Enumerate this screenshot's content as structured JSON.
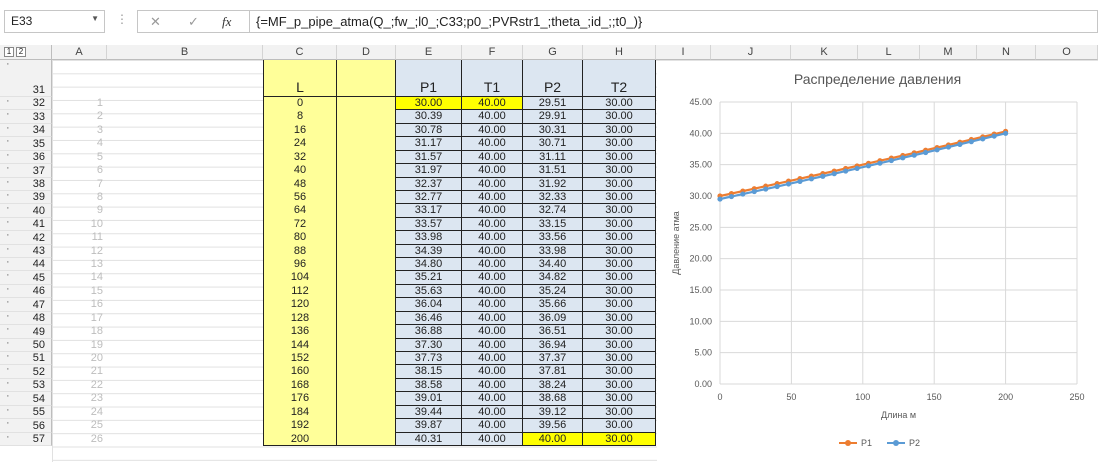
{
  "formula_bar": {
    "name_box": "E33",
    "cancel_icon": "✕",
    "enter_icon": "✓",
    "fx_label": "fx",
    "formula": "{=MF_p_pipe_atma(Q_;fw_;l0_;C33;p0_;PVRstr1_;theta_;id_;;t0_)}"
  },
  "outline_levels": [
    "1",
    "2"
  ],
  "columns": [
    "A",
    "B",
    "C",
    "D",
    "E",
    "F",
    "G",
    "H",
    "I",
    "J",
    "K",
    "L",
    "M",
    "N",
    "O"
  ],
  "header_row": {
    "row": "31",
    "C": "L",
    "E": "P1",
    "F": "T1",
    "G": "P2",
    "H": "T2"
  },
  "rows": [
    {
      "row": "32",
      "A": "1",
      "C": "0",
      "E": "30.00",
      "F": "40.00",
      "G": "29.51",
      "H": "30.00"
    },
    {
      "row": "33",
      "A": "2",
      "C": "8",
      "E": "30.39",
      "F": "40.00",
      "G": "29.91",
      "H": "30.00"
    },
    {
      "row": "34",
      "A": "3",
      "C": "16",
      "E": "30.78",
      "F": "40.00",
      "G": "30.31",
      "H": "30.00"
    },
    {
      "row": "35",
      "A": "4",
      "C": "24",
      "E": "31.17",
      "F": "40.00",
      "G": "30.71",
      "H": "30.00"
    },
    {
      "row": "36",
      "A": "5",
      "C": "32",
      "E": "31.57",
      "F": "40.00",
      "G": "31.11",
      "H": "30.00"
    },
    {
      "row": "37",
      "A": "6",
      "C": "40",
      "E": "31.97",
      "F": "40.00",
      "G": "31.51",
      "H": "30.00"
    },
    {
      "row": "38",
      "A": "7",
      "C": "48",
      "E": "32.37",
      "F": "40.00",
      "G": "31.92",
      "H": "30.00"
    },
    {
      "row": "39",
      "A": "8",
      "C": "56",
      "E": "32.77",
      "F": "40.00",
      "G": "32.33",
      "H": "30.00"
    },
    {
      "row": "40",
      "A": "9",
      "C": "64",
      "E": "33.17",
      "F": "40.00",
      "G": "32.74",
      "H": "30.00"
    },
    {
      "row": "41",
      "A": "10",
      "C": "72",
      "E": "33.57",
      "F": "40.00",
      "G": "33.15",
      "H": "30.00"
    },
    {
      "row": "42",
      "A": "11",
      "C": "80",
      "E": "33.98",
      "F": "40.00",
      "G": "33.56",
      "H": "30.00"
    },
    {
      "row": "43",
      "A": "12",
      "C": "88",
      "E": "34.39",
      "F": "40.00",
      "G": "33.98",
      "H": "30.00"
    },
    {
      "row": "44",
      "A": "13",
      "C": "96",
      "E": "34.80",
      "F": "40.00",
      "G": "34.40",
      "H": "30.00"
    },
    {
      "row": "45",
      "A": "14",
      "C": "104",
      "E": "35.21",
      "F": "40.00",
      "G": "34.82",
      "H": "30.00"
    },
    {
      "row": "46",
      "A": "15",
      "C": "112",
      "E": "35.63",
      "F": "40.00",
      "G": "35.24",
      "H": "30.00"
    },
    {
      "row": "47",
      "A": "16",
      "C": "120",
      "E": "36.04",
      "F": "40.00",
      "G": "35.66",
      "H": "30.00"
    },
    {
      "row": "48",
      "A": "17",
      "C": "128",
      "E": "36.46",
      "F": "40.00",
      "G": "36.09",
      "H": "30.00"
    },
    {
      "row": "49",
      "A": "18",
      "C": "136",
      "E": "36.88",
      "F": "40.00",
      "G": "36.51",
      "H": "30.00"
    },
    {
      "row": "50",
      "A": "19",
      "C": "144",
      "E": "37.30",
      "F": "40.00",
      "G": "36.94",
      "H": "30.00"
    },
    {
      "row": "51",
      "A": "20",
      "C": "152",
      "E": "37.73",
      "F": "40.00",
      "G": "37.37",
      "H": "30.00"
    },
    {
      "row": "52",
      "A": "21",
      "C": "160",
      "E": "38.15",
      "F": "40.00",
      "G": "37.81",
      "H": "30.00"
    },
    {
      "row": "53",
      "A": "22",
      "C": "168",
      "E": "38.58",
      "F": "40.00",
      "G": "38.24",
      "H": "30.00"
    },
    {
      "row": "54",
      "A": "23",
      "C": "176",
      "E": "39.01",
      "F": "40.00",
      "G": "38.68",
      "H": "30.00"
    },
    {
      "row": "55",
      "A": "24",
      "C": "184",
      "E": "39.44",
      "F": "40.00",
      "G": "39.12",
      "H": "30.00"
    },
    {
      "row": "56",
      "A": "25",
      "C": "192",
      "E": "39.87",
      "F": "40.00",
      "G": "39.56",
      "H": "30.00"
    },
    {
      "row": "57",
      "A": "26",
      "C": "200",
      "E": "40.31",
      "F": "40.00",
      "G": "40.00",
      "H": "30.00"
    }
  ],
  "highlight_cells": [
    "32:E",
    "32:F",
    "57:G",
    "57:H"
  ],
  "colors": {
    "p1": "#ed7d31",
    "p2": "#5b9bd5",
    "input_yellow": "#ffff99",
    "highlight": "#ffff00",
    "cell_blue": "#dce6f1"
  },
  "chart_data": {
    "type": "line",
    "title": "Распределение давления",
    "xlabel": "Длина м",
    "ylabel": "Давление атма",
    "xlim": [
      0,
      250
    ],
    "ylim": [
      0,
      45
    ],
    "x_ticks": [
      "0",
      "50",
      "100",
      "150",
      "200",
      "250"
    ],
    "y_ticks": [
      "0.00",
      "5.00",
      "10.00",
      "15.00",
      "20.00",
      "25.00",
      "30.00",
      "35.00",
      "40.00",
      "45.00"
    ],
    "grid": true,
    "legend_position": "bottom",
    "x": [
      0,
      8,
      16,
      24,
      32,
      40,
      48,
      56,
      64,
      72,
      80,
      88,
      96,
      104,
      112,
      120,
      128,
      136,
      144,
      152,
      160,
      168,
      176,
      184,
      192,
      200
    ],
    "series": [
      {
        "name": "P1",
        "color": "#ed7d31",
        "values": [
          30.0,
          30.39,
          30.78,
          31.17,
          31.57,
          31.97,
          32.37,
          32.77,
          33.17,
          33.57,
          33.98,
          34.39,
          34.8,
          35.21,
          35.63,
          36.04,
          36.46,
          36.88,
          37.3,
          37.73,
          38.15,
          38.58,
          39.01,
          39.44,
          39.87,
          40.31
        ]
      },
      {
        "name": "P2",
        "color": "#5b9bd5",
        "values": [
          29.51,
          29.91,
          30.31,
          30.71,
          31.11,
          31.51,
          31.92,
          32.33,
          32.74,
          33.15,
          33.56,
          33.98,
          34.4,
          34.82,
          35.24,
          35.66,
          36.09,
          36.51,
          36.94,
          37.37,
          37.81,
          38.24,
          38.68,
          39.12,
          39.56,
          40.0
        ]
      }
    ]
  }
}
